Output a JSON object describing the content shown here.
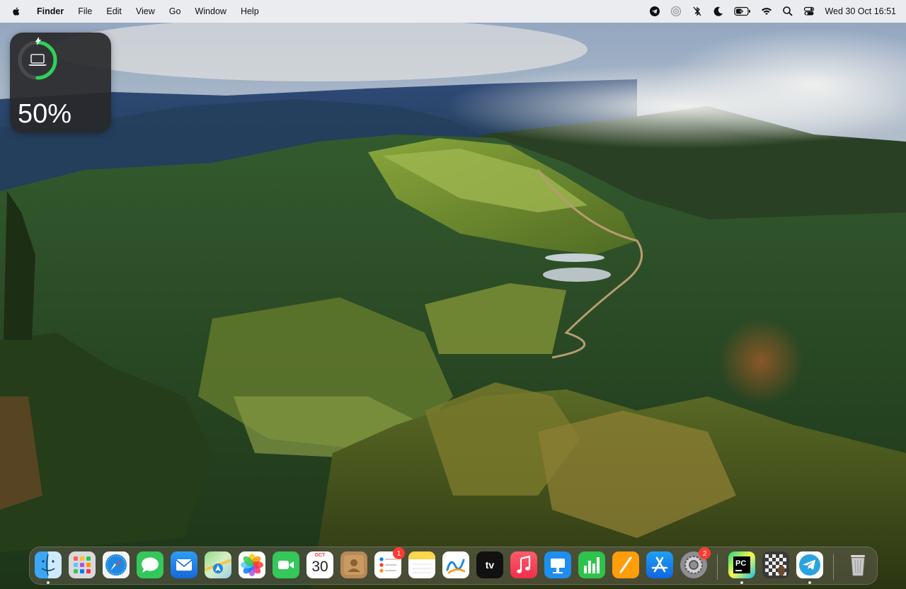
{
  "menubar": {
    "app_name": "Finder",
    "menus": [
      "File",
      "Edit",
      "View",
      "Go",
      "Window",
      "Help"
    ],
    "clock": "Wed 30 Oct  16:51",
    "status_icons": [
      "telegram-icon",
      "screen-mirroring-icon",
      "bluetooth-off-icon",
      "focus-moon-icon",
      "battery-charging-icon",
      "wifi-icon",
      "spotlight-search-icon",
      "control-center-icon"
    ]
  },
  "battery_widget": {
    "percent_label": "50%",
    "level": 0.5,
    "charging": true,
    "device_icon": "laptop-icon"
  },
  "dock": {
    "apps": [
      {
        "name": "Finder",
        "icon": "finder-icon",
        "running": true
      },
      {
        "name": "Launchpad",
        "icon": "launchpad-icon",
        "running": false
      },
      {
        "name": "Safari",
        "icon": "safari-icon",
        "running": false
      },
      {
        "name": "Messages",
        "icon": "messages-icon",
        "running": false
      },
      {
        "name": "Mail",
        "icon": "mail-icon",
        "running": false
      },
      {
        "name": "Maps",
        "icon": "maps-icon",
        "running": false
      },
      {
        "name": "Photos",
        "icon": "photos-icon",
        "running": false
      },
      {
        "name": "FaceTime",
        "icon": "facetime-icon",
        "running": false
      },
      {
        "name": "Calendar",
        "icon": "calendar-icon",
        "running": false,
        "month": "OCT",
        "day": "30"
      },
      {
        "name": "Contacts",
        "icon": "contacts-icon",
        "running": false
      },
      {
        "name": "Reminders",
        "icon": "reminders-icon",
        "running": false,
        "badge": "1"
      },
      {
        "name": "Notes",
        "icon": "notes-icon",
        "running": false
      },
      {
        "name": "Freeform",
        "icon": "freeform-icon",
        "running": false
      },
      {
        "name": "TV",
        "icon": "apple-tv-icon",
        "running": false,
        "label": "tv"
      },
      {
        "name": "Music",
        "icon": "music-icon",
        "running": false
      },
      {
        "name": "Keynote",
        "icon": "keynote-icon",
        "running": false
      },
      {
        "name": "Numbers",
        "icon": "numbers-icon",
        "running": false
      },
      {
        "name": "Pages",
        "icon": "pages-icon",
        "running": false
      },
      {
        "name": "App Store",
        "icon": "app-store-icon",
        "running": false
      },
      {
        "name": "System Settings",
        "icon": "system-settings-icon",
        "running": false,
        "badge": "2"
      },
      {
        "name": "PyCharm",
        "icon": "pycharm-icon",
        "running": true
      },
      {
        "name": "Chess",
        "icon": "chess-icon",
        "running": false
      },
      {
        "name": "Telegram",
        "icon": "telegram-icon",
        "running": true
      },
      {
        "name": "Trash",
        "icon": "trash-icon",
        "running": false
      }
    ]
  },
  "colors": {
    "accent_green": "#30d158",
    "badge_red": "#ff3b30",
    "menubar_bg": "#eeeef0"
  }
}
